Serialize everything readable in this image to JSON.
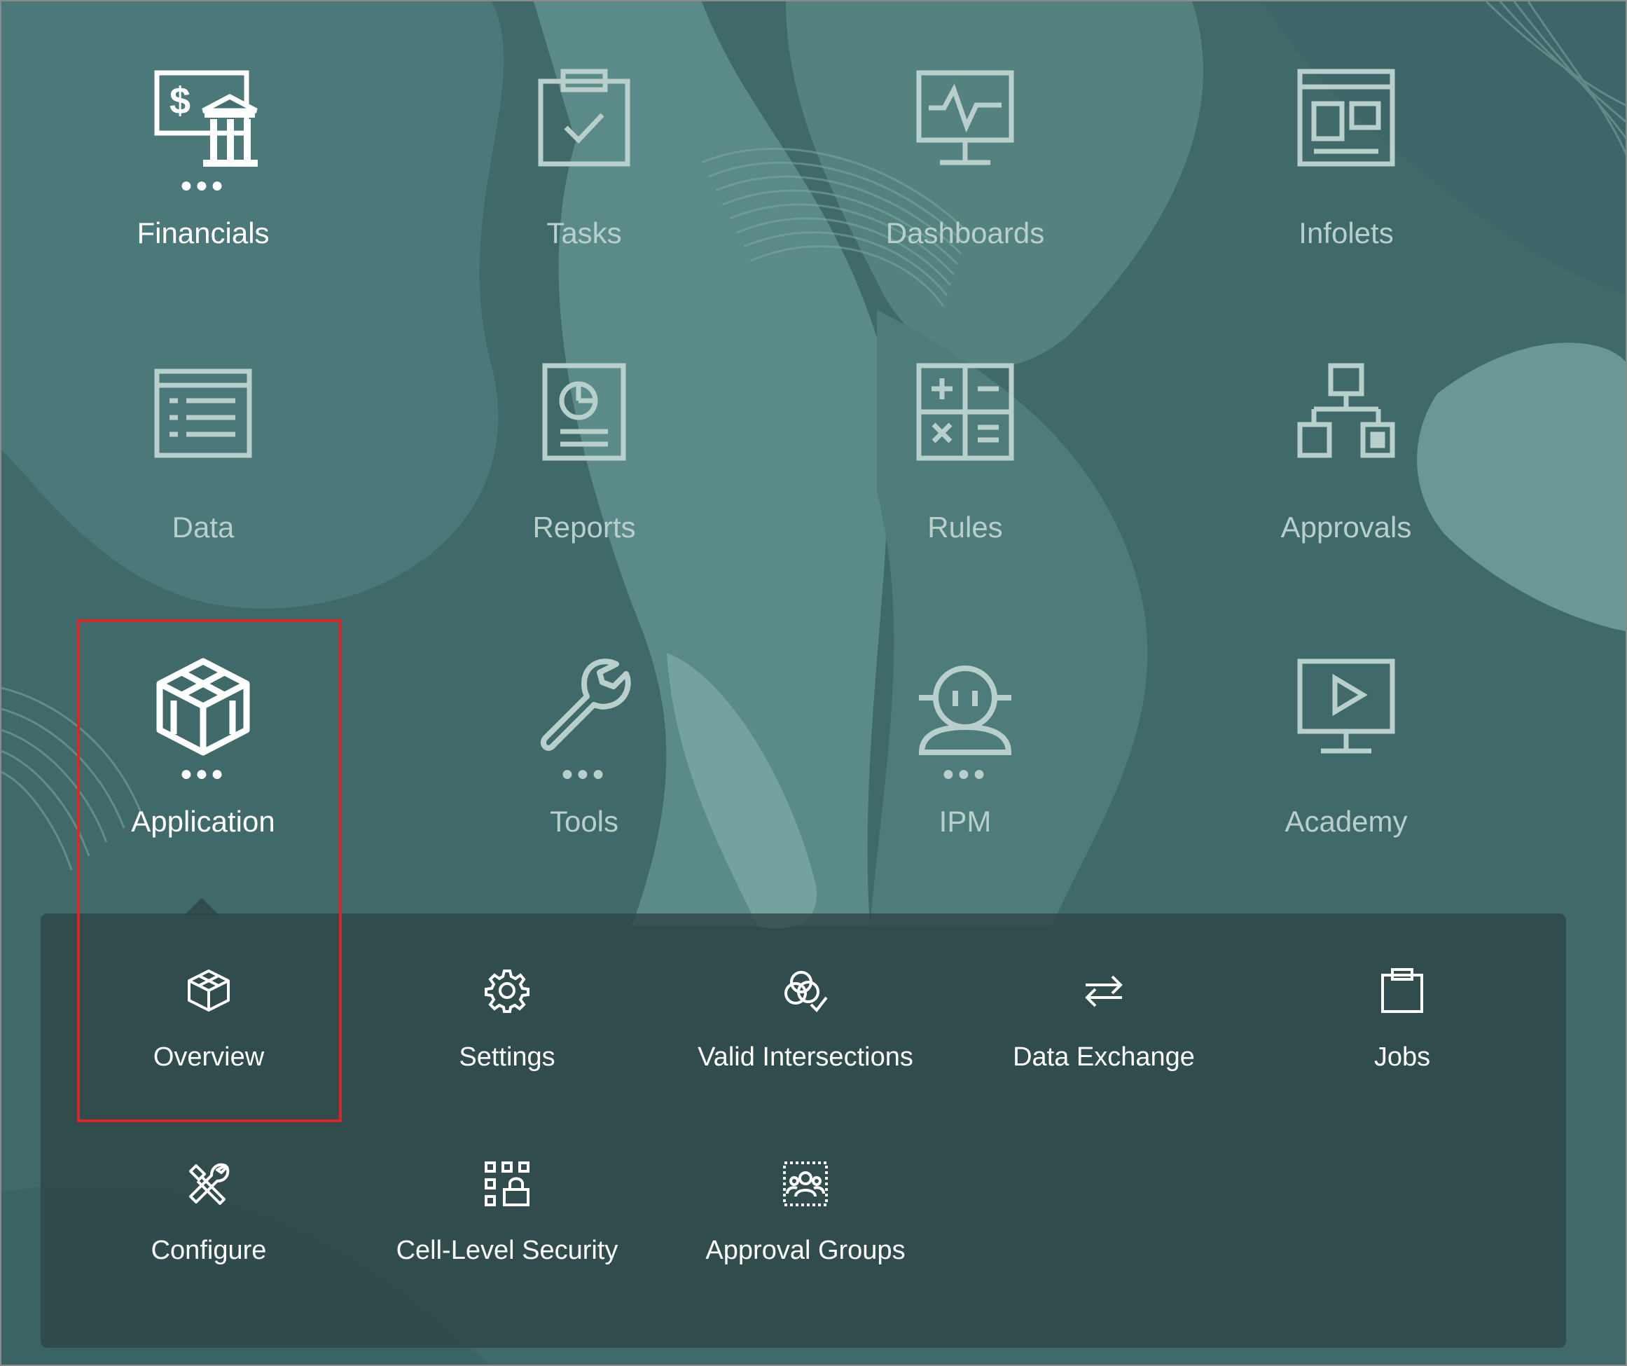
{
  "theme": {
    "tile_active_color": "#ffffff",
    "tile_inactive_color": "#b9cfcc",
    "highlight_color": "#d92626"
  },
  "tiles": [
    {
      "label": "Financials",
      "icon": "financials-icon",
      "has_submenu": true,
      "active": true
    },
    {
      "label": "Tasks",
      "icon": "clipboard-check-icon",
      "has_submenu": false
    },
    {
      "label": "Dashboards",
      "icon": "monitor-pulse-icon",
      "has_submenu": false
    },
    {
      "label": "Infolets",
      "icon": "infolets-icon",
      "has_submenu": false
    },
    {
      "label": "Data",
      "icon": "data-grid-icon",
      "has_submenu": false
    },
    {
      "label": "Reports",
      "icon": "report-pie-icon",
      "has_submenu": false
    },
    {
      "label": "Rules",
      "icon": "calculator-icon",
      "has_submenu": false
    },
    {
      "label": "Approvals",
      "icon": "hierarchy-icon",
      "has_submenu": false
    },
    {
      "label": "Application",
      "icon": "cube-icon",
      "has_submenu": true,
      "active": true,
      "expanded": true
    },
    {
      "label": "Tools",
      "icon": "wrench-icon",
      "has_submenu": true
    },
    {
      "label": "IPM",
      "icon": "robot-icon",
      "has_submenu": true
    },
    {
      "label": "Academy",
      "icon": "monitor-play-icon",
      "has_submenu": false
    }
  ],
  "submenu": [
    {
      "label": "Overview",
      "icon": "cube-outline-icon",
      "highlighted": true
    },
    {
      "label": "Settings",
      "icon": "gear-icon"
    },
    {
      "label": "Valid Intersections",
      "icon": "venn-check-icon"
    },
    {
      "label": "Data Exchange",
      "icon": "swap-arrows-icon"
    },
    {
      "label": "Jobs",
      "icon": "clipboard-icon"
    },
    {
      "label": "Configure",
      "icon": "tools-cross-icon"
    },
    {
      "label": "Cell-Level Security",
      "icon": "grid-lock-icon"
    },
    {
      "label": "Approval Groups",
      "icon": "user-group-icon"
    }
  ]
}
